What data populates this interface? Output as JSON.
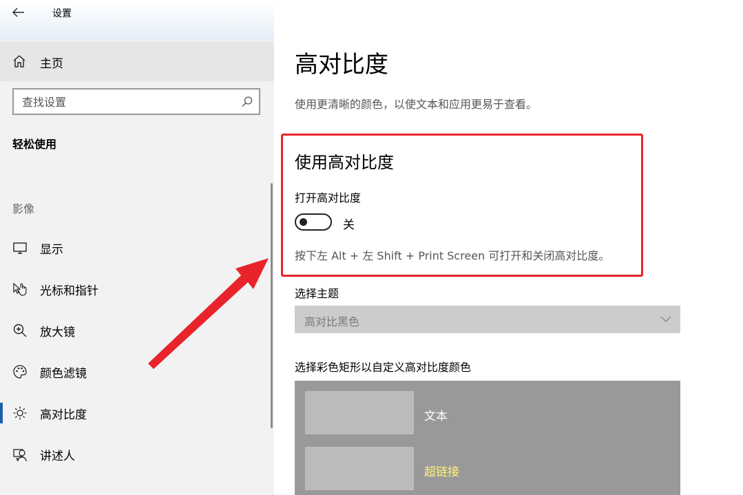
{
  "window": {
    "title": "设置"
  },
  "sidebar": {
    "home_label": "主页",
    "search_placeholder": "查找设置",
    "section_title": "轻松使用",
    "group_label": "影像",
    "items": [
      {
        "label": "显示",
        "icon": "monitor-icon"
      },
      {
        "label": "光标和指针",
        "icon": "pointer-hand-icon"
      },
      {
        "label": "放大镜",
        "icon": "magnifier-icon"
      },
      {
        "label": "颜色滤镜",
        "icon": "palette-icon"
      },
      {
        "label": "高对比度",
        "icon": "brightness-icon",
        "selected": true
      },
      {
        "label": "讲述人",
        "icon": "narrator-icon"
      }
    ]
  },
  "main": {
    "title": "高对比度",
    "description": "使用更清晰的颜色，以使文本和应用更易于查看。",
    "high_contrast": {
      "heading": "使用高对比度",
      "toggle_label": "打开高对比度",
      "toggle_state": "关",
      "shortcut_hint": "按下左 Alt + 左 Shift + Print Screen 可打开和关闭高对比度。"
    },
    "theme": {
      "label": "选择主题",
      "selected": "高对比黑色"
    },
    "customize": {
      "label": "选择彩色矩形以自定义高对比度颜色",
      "swatches": [
        {
          "label": "文本",
          "label_color": "#ffffff"
        },
        {
          "label": "超链接",
          "label_color": "#fff27a"
        }
      ]
    }
  },
  "colors": {
    "annotation": "#e8232a",
    "selection_bar": "#1f5fa8"
  }
}
